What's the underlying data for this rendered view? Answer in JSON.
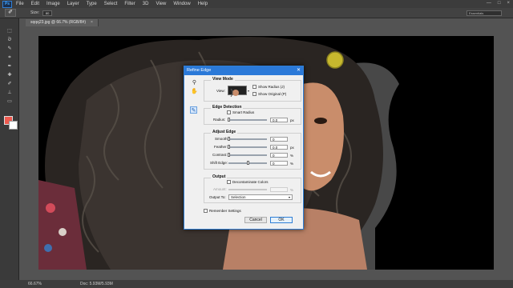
{
  "menubar": {
    "logo": "Ps",
    "items": [
      "File",
      "Edit",
      "Image",
      "Layer",
      "Type",
      "Select",
      "Filter",
      "3D",
      "View",
      "Window",
      "Help"
    ],
    "controls": [
      "—",
      "□",
      "×"
    ]
  },
  "options": {
    "tool_glyph": "✐",
    "size_label": "Size:",
    "size_value": "80",
    "workspace": "Essentials"
  },
  "document": {
    "tab_title": "sqqq23.jpg @ 66.7% (RGB/8#)",
    "close_glyph": "×"
  },
  "status": {
    "zoom": "66.67%",
    "doc_size": "Doc: 5.93M/5.93M"
  },
  "colors": {
    "foreground": "#ef5a4f",
    "background": "#ffffff",
    "dialog_accent": "#2b79d8"
  },
  "dialog": {
    "title": "Refine Edge",
    "close_glyph": "✕",
    "tool_icons": [
      "zoom-icon",
      "hand-icon",
      "refine-radius-brush-icon"
    ],
    "view_mode": {
      "title": "View Mode",
      "view_label": "View:",
      "show_radius": "Show Radius (J)",
      "show_original": "Show Original (P)"
    },
    "edge_detection": {
      "title": "Edge Detection",
      "smart_radius": "Smart Radius",
      "radius_label": "Radius:",
      "radius_value": "0.0",
      "radius_unit": "px",
      "radius_level": 0.0
    },
    "adjust_edge": {
      "title": "Adjust Edge",
      "smooth_label": "Smooth:",
      "smooth_value": "0",
      "smooth_level": 0.0,
      "feather_label": "Feather:",
      "feather_value": "0.0",
      "feather_unit": "px",
      "feather_level": 0.0,
      "contrast_label": "Contrast:",
      "contrast_value": "0",
      "contrast_unit": "%",
      "contrast_level": 0.0,
      "shift_label": "Shift Edge:",
      "shift_value": "0",
      "shift_unit": "%",
      "shift_level": 0.5
    },
    "output": {
      "title": "Output",
      "decontaminate": "Decontaminate Colors",
      "amount_label": "Amount:",
      "amount_unit": "%",
      "output_to_label": "Output To:",
      "output_to_value": "Selection"
    },
    "remember": "Remember Settings",
    "cancel": "Cancel",
    "ok": "OK"
  }
}
